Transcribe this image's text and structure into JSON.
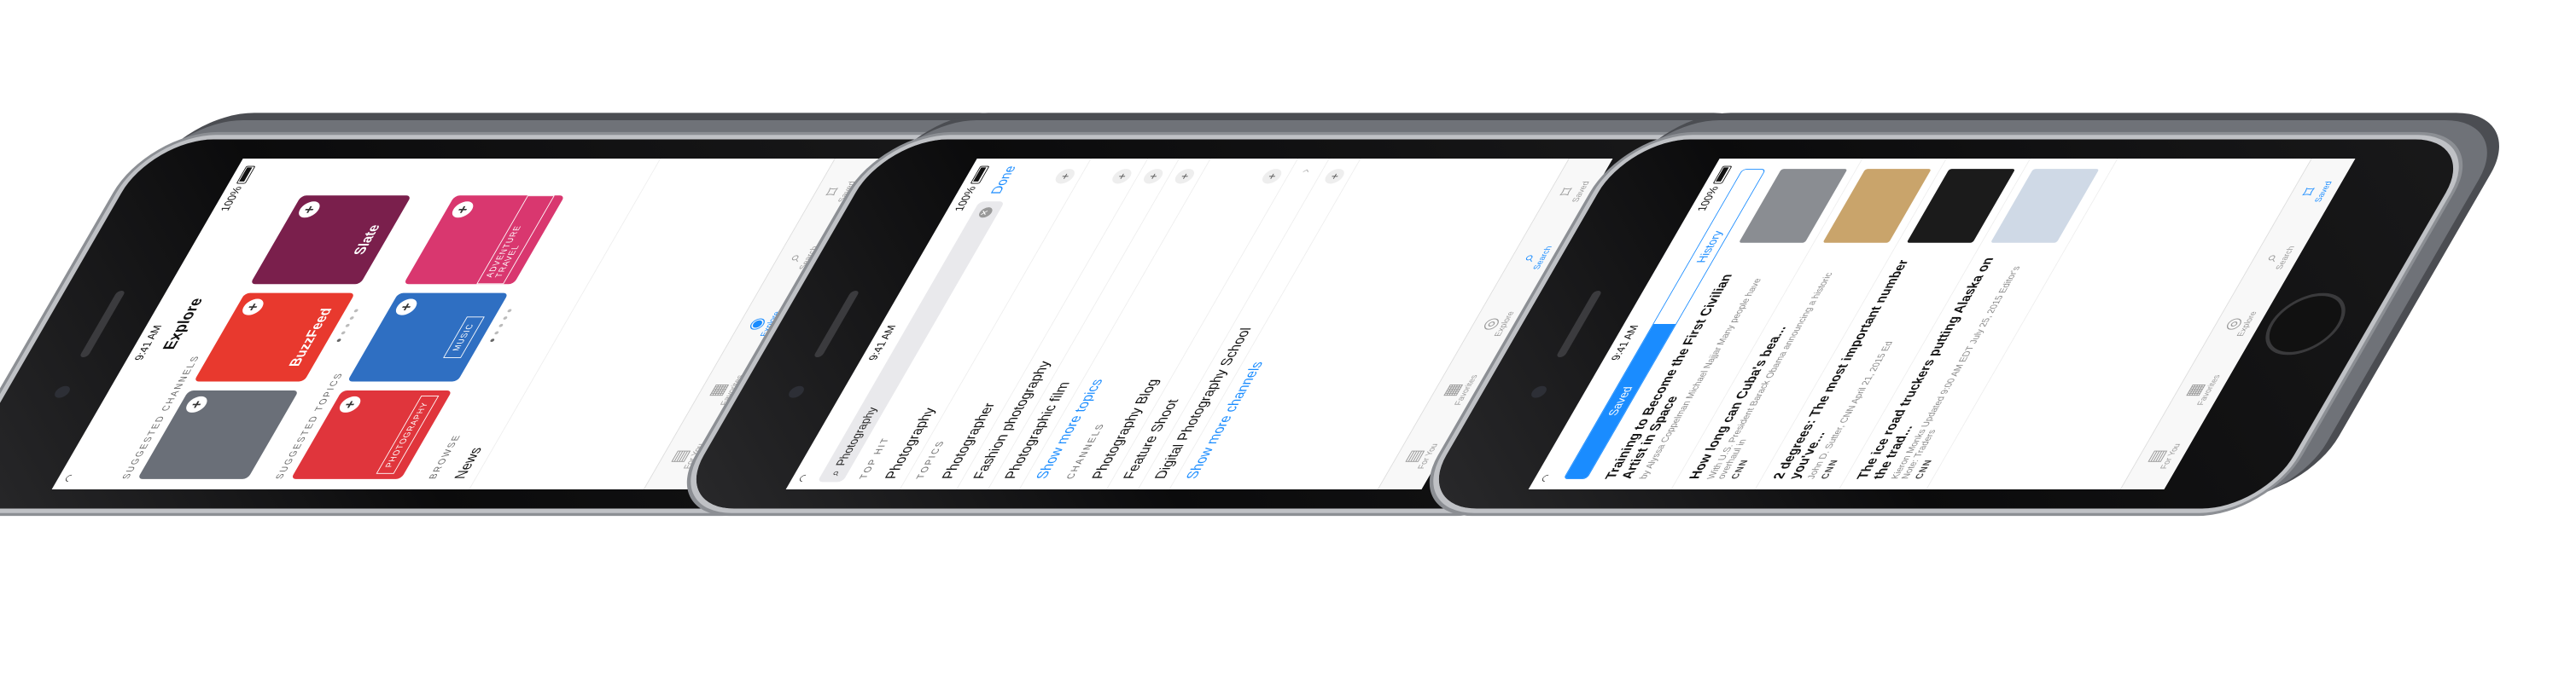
{
  "status": {
    "time": "9:41 AM",
    "battery": "100%"
  },
  "explore": {
    "title": "Explore",
    "suggested_channels_label": "SUGGESTED CHANNELS",
    "channels": [
      {
        "name": "",
        "color": "#6a6f78"
      },
      {
        "name": "BuzzFeed",
        "color": "#e8392e"
      },
      {
        "name": "Slate",
        "color": "#7a1f4c"
      }
    ],
    "suggested_topics_label": "SUGGESTED TOPICS",
    "topics": [
      {
        "name": "PHOTOGRAPHY",
        "color": "#e0353c"
      },
      {
        "name": "MUSIC",
        "color": "#2f6fc2"
      },
      {
        "name": "ADVENTURE TRAVEL",
        "color": "#d9376f"
      }
    ],
    "browse_label": "BROWSE",
    "browse_first": "News"
  },
  "search": {
    "query": "Photography",
    "done_label": "Done",
    "top_hit_label": "TOP HIT",
    "top_hit": "Photography",
    "topics_label": "TOPICS",
    "topics": [
      "Photographer",
      "Fashion photography",
      "Photographic film"
    ],
    "show_more_topics": "Show more topics",
    "channels_label": "CHANNELS",
    "channels": [
      "Photography Blog",
      "Feature Shoot",
      "Digital Photography School"
    ],
    "show_more_channels": "Show more channels"
  },
  "saved": {
    "seg_saved": "Saved",
    "seg_history": "History",
    "articles": [
      {
        "headline": "Training to Become the First Civilian Artist in Space",
        "byline": "by Alyssa Coppelman Michael Najjar Many people have",
        "source": "",
        "thumb_color": "#8a8d92"
      },
      {
        "headline": "How long can Cuba's bea...",
        "byline": "With U.S. President Barack Obama announcing a historic overhaul in",
        "source": "CNN",
        "thumb_color": "#c9a46b"
      },
      {
        "headline": "2 degrees: The most important number you've...",
        "byline": "John D. Sutter, CNN April 21, 2015 Ed",
        "source": "CNN",
        "thumb_color": "#1b1b1b"
      },
      {
        "headline": "The ice road truckers putting Alaska on the trad...",
        "byline": "Kieron Monks Updated 9:00 AM EDT July 25, 2015 Editor's Note: Traders",
        "source": "CNN",
        "thumb_color": "#cfd9e6"
      }
    ]
  },
  "tabs": {
    "for_you": "For You",
    "favorites": "Favorites",
    "explore": "Explore",
    "search": "Search",
    "saved": "Saved"
  },
  "colors": {
    "accent": "#1a8cff"
  }
}
